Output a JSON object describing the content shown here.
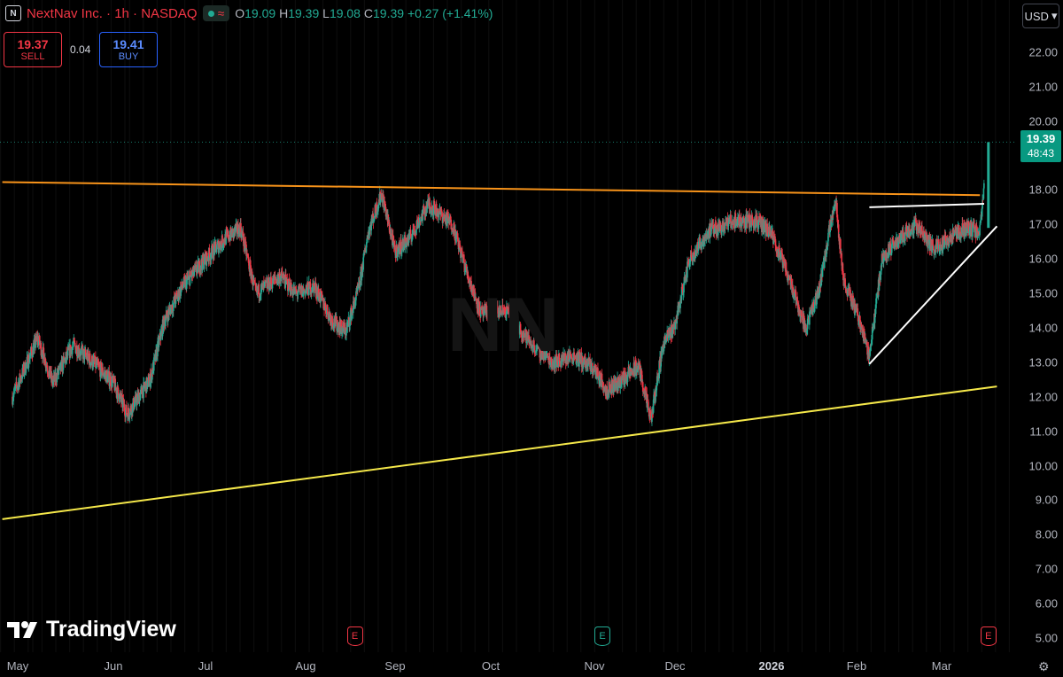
{
  "header": {
    "logo_letter": "N",
    "symbol": "NextNav Inc. · 1h · NASDAQ",
    "open_label": "O",
    "open": "19.09",
    "high_label": "H",
    "high": "19.39",
    "low_label": "L",
    "low": "19.08",
    "close_label": "C",
    "close": "19.39",
    "change": "+0.27 (+1.41%)",
    "status_icon": "market-open-dot-icon",
    "wave_icon": "≈"
  },
  "trade": {
    "sell_price": "19.37",
    "sell_label": "SELL",
    "spread": "0.04",
    "buy_price": "19.41",
    "buy_label": "BUY"
  },
  "currency": "USD",
  "price_tag": {
    "price": "19.39",
    "countdown": "48:43"
  },
  "watermark": "NN",
  "brand": "TradingView",
  "earnings_marker": "E",
  "colors": {
    "up": "#22ab94",
    "down": "#f23645",
    "orange_line": "#f7931a",
    "yellow_line": "#f5e84a",
    "white_line": "#ffffff",
    "sell": "#f23645",
    "buy": "#2962ff"
  },
  "chart_data": {
    "type": "candlestick",
    "timeframe": "1h",
    "ylim": [
      4.6,
      23.2
    ],
    "y_ticks": [
      "22.00",
      "21.00",
      "20.00",
      "18.00",
      "17.00",
      "16.00",
      "15.00",
      "14.00",
      "13.00",
      "12.00",
      "11.00",
      "10.00",
      "9.00",
      "8.00",
      "7.00",
      "6.00",
      "5.00"
    ],
    "x_ticks": [
      "May",
      "Jun",
      "Jul",
      "Aug",
      "Sep",
      "Oct",
      "Nov",
      "Dec",
      "2026",
      "Feb",
      "Mar"
    ],
    "close_path": [
      {
        "month": 0.0,
        "price": 12.0
      },
      {
        "month": 0.25,
        "price": 13.7
      },
      {
        "month": 0.4,
        "price": 12.4
      },
      {
        "month": 0.6,
        "price": 13.5
      },
      {
        "month": 0.8,
        "price": 13.0
      },
      {
        "month": 1.0,
        "price": 12.4
      },
      {
        "month": 1.15,
        "price": 11.5
      },
      {
        "month": 1.4,
        "price": 12.5
      },
      {
        "month": 1.55,
        "price": 14.2
      },
      {
        "month": 1.75,
        "price": 15.2
      },
      {
        "month": 2.0,
        "price": 16.0
      },
      {
        "month": 2.2,
        "price": 16.6
      },
      {
        "month": 2.35,
        "price": 16.9
      },
      {
        "month": 2.5,
        "price": 15.0
      },
      {
        "month": 2.75,
        "price": 15.5
      },
      {
        "month": 2.9,
        "price": 15.0
      },
      {
        "month": 3.1,
        "price": 15.2
      },
      {
        "month": 3.3,
        "price": 14.2
      },
      {
        "month": 3.45,
        "price": 13.9
      },
      {
        "month": 3.6,
        "price": 15.2
      },
      {
        "month": 3.7,
        "price": 16.8
      },
      {
        "month": 3.85,
        "price": 17.9
      },
      {
        "month": 4.0,
        "price": 16.2
      },
      {
        "month": 4.15,
        "price": 16.6
      },
      {
        "month": 4.35,
        "price": 17.6
      },
      {
        "month": 4.6,
        "price": 17.0
      },
      {
        "month": 4.75,
        "price": 15.6
      },
      {
        "month": 4.9,
        "price": 14.4
      },
      {
        "month": 5.15,
        "price": 14.5
      },
      {
        "month": 5.4,
        "price": 13.5
      },
      {
        "month": 5.6,
        "price": 13.0
      },
      {
        "month": 5.8,
        "price": 13.2
      },
      {
        "month": 6.0,
        "price": 12.8
      },
      {
        "month": 6.15,
        "price": 12.2
      },
      {
        "month": 6.35,
        "price": 12.5
      },
      {
        "month": 6.55,
        "price": 12.9
      },
      {
        "month": 6.7,
        "price": 11.3
      },
      {
        "month": 6.85,
        "price": 13.5
      },
      {
        "month": 7.0,
        "price": 14.1
      },
      {
        "month": 7.15,
        "price": 16.0
      },
      {
        "month": 7.35,
        "price": 16.8
      },
      {
        "month": 7.6,
        "price": 17.1
      },
      {
        "month": 7.85,
        "price": 17.1
      },
      {
        "month": 8.0,
        "price": 16.7
      },
      {
        "month": 8.2,
        "price": 15.5
      },
      {
        "month": 8.4,
        "price": 14.0
      },
      {
        "month": 8.55,
        "price": 15.0
      },
      {
        "month": 8.75,
        "price": 17.8
      },
      {
        "month": 8.85,
        "price": 15.3
      },
      {
        "month": 9.0,
        "price": 14.5
      },
      {
        "month": 9.15,
        "price": 13.2
      },
      {
        "month": 9.3,
        "price": 16.0
      },
      {
        "month": 9.5,
        "price": 16.6
      },
      {
        "month": 9.7,
        "price": 17.0
      },
      {
        "month": 9.9,
        "price": 16.3
      },
      {
        "month": 10.1,
        "price": 16.6
      },
      {
        "month": 10.3,
        "price": 16.9
      },
      {
        "month": 10.45,
        "price": 16.8
      },
      {
        "month": 10.55,
        "price": 19.39
      }
    ],
    "trendlines": [
      {
        "color": "orange",
        "from": {
          "month": -0.1,
          "price": 18.23
        },
        "to": {
          "month": 10.45,
          "price": 17.85
        }
      },
      {
        "color": "yellow",
        "from": {
          "month": -0.1,
          "price": 8.45
        },
        "to": {
          "month": 10.65,
          "price": 12.3
        }
      },
      {
        "color": "white",
        "from": {
          "month": 9.15,
          "price": 17.5
        },
        "to": {
          "month": 10.5,
          "price": 17.6
        }
      },
      {
        "color": "white",
        "from": {
          "month": 9.15,
          "price": 12.95
        },
        "to": {
          "month": 10.65,
          "price": 16.95
        }
      }
    ],
    "earnings_months": [
      {
        "month": 3.55,
        "type": "red"
      },
      {
        "month": 6.1,
        "type": "green"
      },
      {
        "month": 10.55,
        "type": "red"
      }
    ],
    "last_price": 19.39
  }
}
